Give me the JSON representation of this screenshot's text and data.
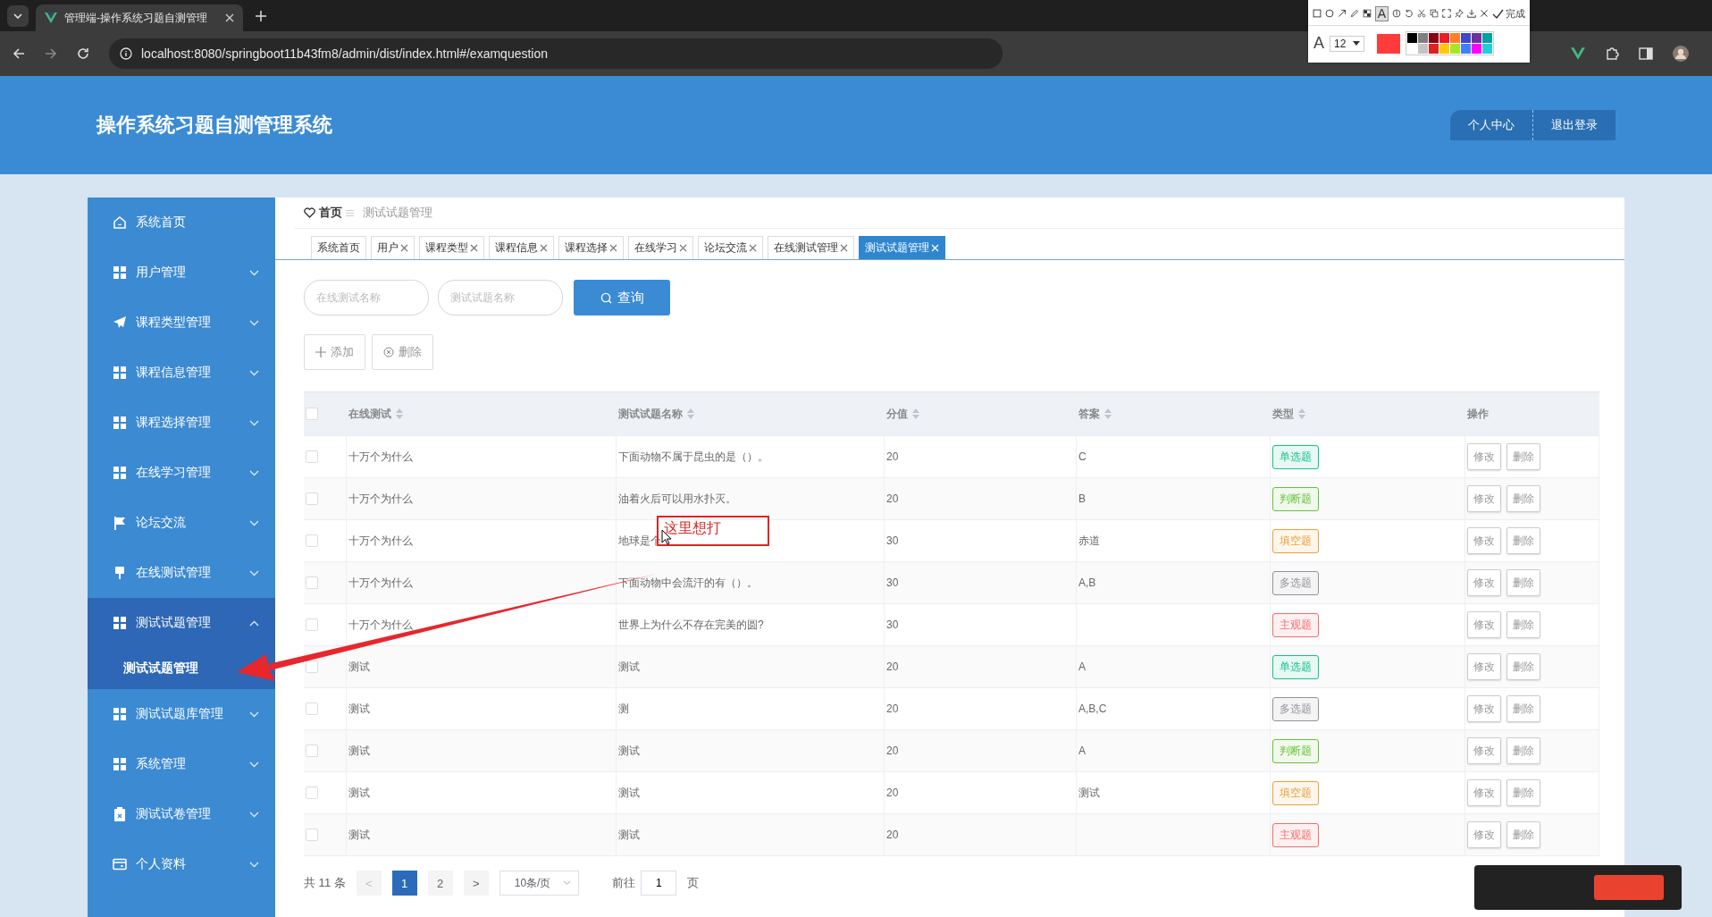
{
  "browser": {
    "tab_title": "管理端-操作系统习题自测管理",
    "url": "localhost:8080/springboot11b43fm8/admin/dist/index.html#/examquestion"
  },
  "annotation_toolbar": {
    "text_tool": "A",
    "font_tool": "A",
    "font_size": "12",
    "done": "完成",
    "color": "#ff3b3b"
  },
  "header": {
    "title": "操作系统习题自测管理系统",
    "buttons": [
      "个人中心",
      "退出登录"
    ]
  },
  "sidebar": {
    "items": [
      {
        "label": "系统首页",
        "kind": "link"
      },
      {
        "label": "用户管理",
        "kind": "menu",
        "expanded": false
      },
      {
        "label": "课程类型管理",
        "kind": "menu",
        "expanded": false
      },
      {
        "label": "课程信息管理",
        "kind": "menu",
        "expanded": false
      },
      {
        "label": "课程选择管理",
        "kind": "menu",
        "expanded": false
      },
      {
        "label": "在线学习管理",
        "kind": "menu",
        "expanded": false
      },
      {
        "label": "论坛交流",
        "kind": "menu",
        "expanded": false
      },
      {
        "label": "在线测试管理",
        "kind": "menu",
        "expanded": false
      },
      {
        "label": "测试试题管理",
        "kind": "menu",
        "expanded": true,
        "children": [
          {
            "label": "测试试题管理",
            "selected": true
          }
        ]
      },
      {
        "label": "测试试题库管理",
        "kind": "menu",
        "expanded": false
      },
      {
        "label": "系统管理",
        "kind": "menu",
        "expanded": false
      },
      {
        "label": "测试试卷管理",
        "kind": "menu",
        "expanded": false
      },
      {
        "label": "个人资料",
        "kind": "menu",
        "expanded": false
      }
    ]
  },
  "breadcrumb": [
    "首页",
    "测试试题管理"
  ],
  "tabs": [
    {
      "label": "系统首页",
      "closable": false,
      "selected": false
    },
    {
      "label": "用户",
      "closable": true,
      "selected": false
    },
    {
      "label": "课程类型",
      "closable": true,
      "selected": false
    },
    {
      "label": "课程信息",
      "closable": true,
      "selected": false
    },
    {
      "label": "课程选择",
      "closable": true,
      "selected": false
    },
    {
      "label": "在线学习",
      "closable": true,
      "selected": false
    },
    {
      "label": "论坛交流",
      "closable": true,
      "selected": false
    },
    {
      "label": "在线测试管理",
      "closable": true,
      "selected": false
    },
    {
      "label": "测试试题管理",
      "closable": true,
      "selected": true
    }
  ],
  "search": {
    "fields": [
      {
        "placeholder": "在线测试名称"
      },
      {
        "placeholder": "测试试题名称"
      }
    ],
    "button": "查询"
  },
  "actions": [
    "添加",
    "删除"
  ],
  "table": {
    "all_checked": false,
    "columns": [
      "在线测试",
      "测试试题名称",
      "分值",
      "答案",
      "类型",
      "操作"
    ],
    "rows": [
      {
        "checked": false,
        "test": "十万个为什么",
        "question": "下面动物不属于昆虫的是（）。",
        "score": "20",
        "answer": "C",
        "type": "单选题",
        "color": "#13c28a",
        "buttons": [
          "修改",
          "删除"
        ]
      },
      {
        "checked": false,
        "test": "十万个为什么",
        "question": "油着火后可以用水扑灭。",
        "score": "20",
        "answer": "B",
        "type": "判断题",
        "color": "#67c23a",
        "buttons": [
          "修改",
          "删除"
        ]
      },
      {
        "checked": false,
        "test": "十万个为什么",
        "question": "地球是个",
        "score": "30",
        "answer": "赤道",
        "type": "填空题",
        "color": "#e6a23c",
        "buttons": [
          "修改",
          "删除"
        ]
      },
      {
        "checked": false,
        "test": "十万个为什么",
        "question": "下面动物中会流汗的有（）。",
        "score": "30",
        "answer": "A,B",
        "type": "多选题",
        "color": "#909399",
        "buttons": [
          "修改",
          "删除"
        ]
      },
      {
        "checked": false,
        "test": "十万个为什么",
        "question": "世界上为什么不存在完美的圆?",
        "score": "30",
        "answer": "",
        "type": "主观题",
        "color": "#f56c6c",
        "buttons": [
          "修改",
          "删除"
        ]
      },
      {
        "checked": false,
        "test": "测试",
        "question": "测试",
        "score": "20",
        "answer": "A",
        "type": "单选题",
        "color": "#13c28a",
        "buttons": [
          "修改",
          "删除"
        ]
      },
      {
        "checked": false,
        "test": "测试",
        "question": "测",
        "score": "20",
        "answer": "A,B,C",
        "type": "多选题",
        "color": "#909399",
        "buttons": [
          "修改",
          "删除"
        ]
      },
      {
        "checked": false,
        "test": "测试",
        "question": "测试",
        "score": "20",
        "answer": "A",
        "type": "判断题",
        "color": "#67c23a",
        "buttons": [
          "修改",
          "删除"
        ]
      },
      {
        "checked": false,
        "test": "测试",
        "question": "测试",
        "score": "20",
        "answer": "测试",
        "type": "填空题",
        "color": "#e6a23c",
        "buttons": [
          "修改",
          "删除"
        ]
      },
      {
        "checked": false,
        "test": "测试",
        "question": "测试",
        "score": "20",
        "answer": "",
        "type": "主观题",
        "color": "#f56c6c",
        "buttons": [
          "修改",
          "删除"
        ]
      }
    ]
  },
  "pagination": {
    "total": "共 11 条",
    "prev": "<",
    "pages": [
      {
        "label": "1",
        "selected": true
      },
      {
        "label": "2",
        "selected": false
      }
    ],
    "next": ">",
    "page_size": "10条/页",
    "goto_label": "前往",
    "goto_value": "1",
    "goto_unit": "页"
  },
  "annotation": {
    "text": "这里想打"
  }
}
